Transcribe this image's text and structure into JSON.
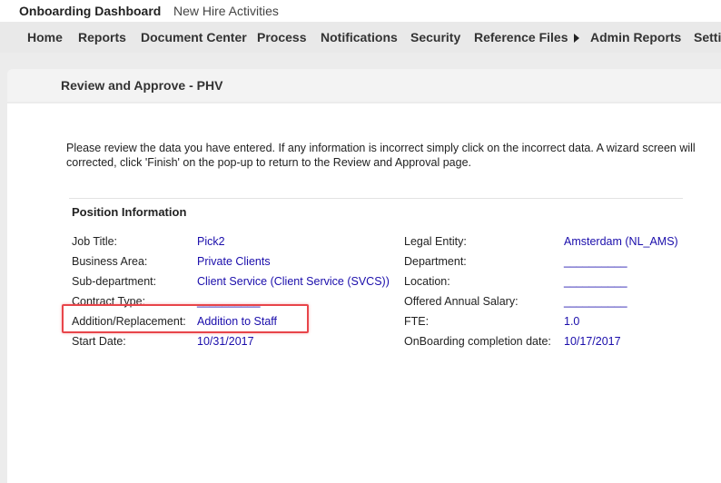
{
  "top_tabs": {
    "dashboard": "Onboarding Dashboard",
    "new_hire": "New Hire Activities"
  },
  "nav": {
    "home": "Home",
    "reports": "Reports",
    "document_center": "Document Center",
    "process": "Process",
    "notifications": "Notifications",
    "security": "Security",
    "reference_files": "Reference Files",
    "admin_reports": "Admin Reports",
    "settings": "Settin"
  },
  "page": {
    "title": "Review and Approve - PHV",
    "intro_line1": "Please review the data you have entered. If any information is incorrect simply click on the incorrect data. A wizard screen will",
    "intro_line2": "corrected, click 'Finish' on the pop-up to return to the Review and Approval page."
  },
  "position_info": {
    "section_title": "Position Information",
    "left": [
      {
        "label": "Job Title:",
        "value": "Pick2"
      },
      {
        "label": "Business Area:",
        "value": "Private Clients"
      },
      {
        "label": "Sub-department:",
        "value": "Client Service (Client Service (SVCS))"
      },
      {
        "label": "Contract Type:",
        "value": "__________"
      },
      {
        "label": "Addition/Replacement:",
        "value": "Addition to Staff"
      },
      {
        "label": "Start Date:",
        "value": "10/31/2017"
      }
    ],
    "right": [
      {
        "label": "Legal Entity:",
        "value": "Amsterdam (NL_AMS)"
      },
      {
        "label": "Department:",
        "value": "__________"
      },
      {
        "label": "Location:",
        "value": "__________"
      },
      {
        "label": "Offered Annual Salary:",
        "value": "__________"
      },
      {
        "label": "FTE:",
        "value": "1.0"
      },
      {
        "label": "OnBoarding completion date:",
        "value": "10/17/2017"
      }
    ]
  },
  "colors": {
    "link": "#1a0dab",
    "highlight": "#e8454a"
  }
}
